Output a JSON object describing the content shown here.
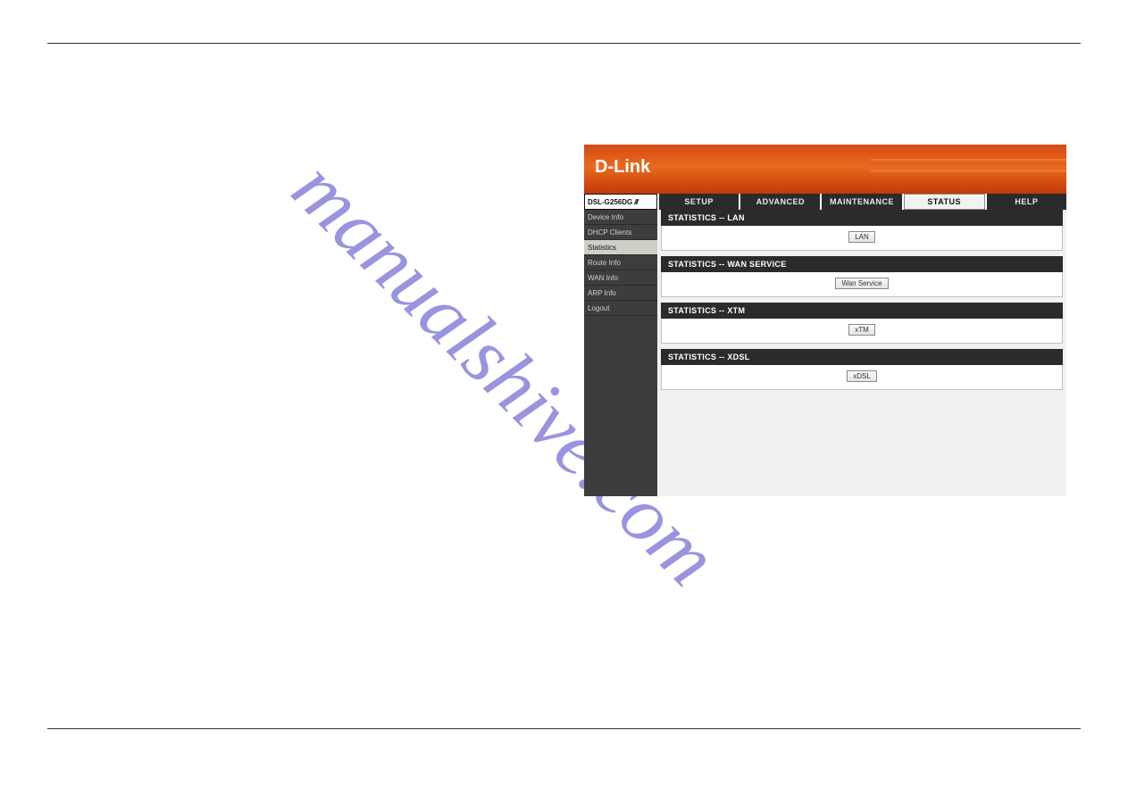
{
  "brand": "D-Link",
  "model": "DSL-G256DG",
  "watermark": "manualshive.com",
  "top_tabs": [
    {
      "label": "SETUP",
      "active": false
    },
    {
      "label": "ADVANCED",
      "active": false
    },
    {
      "label": "MAINTENANCE",
      "active": false
    },
    {
      "label": "STATUS",
      "active": true
    },
    {
      "label": "HELP",
      "active": false
    }
  ],
  "sidebar": [
    {
      "label": "Device Info",
      "active": false
    },
    {
      "label": "DHCP Clients",
      "active": false
    },
    {
      "label": "Statistics",
      "active": true
    },
    {
      "label": "Route Info",
      "active": false
    },
    {
      "label": "WAN Info",
      "active": false
    },
    {
      "label": "ARP Info",
      "active": false
    },
    {
      "label": "Logout",
      "active": false
    }
  ],
  "sections": [
    {
      "title": "STATISTICS -- LAN",
      "button": "LAN"
    },
    {
      "title": "STATISTICS -- WAN SERVICE",
      "button": "Wan Service"
    },
    {
      "title": "STATISTICS -- XTM",
      "button": "xTM"
    },
    {
      "title": "STATISTICS -- XDSL",
      "button": "xDSL"
    }
  ]
}
